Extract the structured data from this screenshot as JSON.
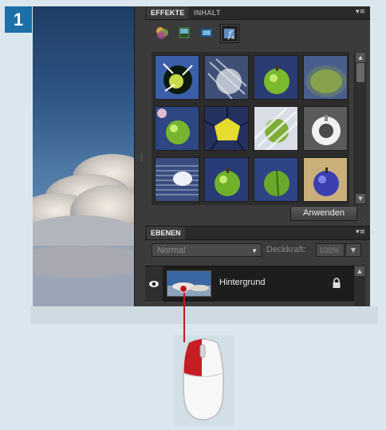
{
  "step_number": "1",
  "effects_panel": {
    "tabs": [
      "EFFEKTE",
      "INHALT"
    ],
    "active_tab": "EFFEKTE",
    "menu_icon": "panel-menu-icon",
    "tool_icons": [
      "color-filter-icon",
      "layer-styles-icon",
      "photo-effects-icon",
      "fx-filter-icon"
    ],
    "selected_tool": "fx-filter-icon",
    "thumbnails": [
      {
        "name": "effect-thumb-1"
      },
      {
        "name": "effect-thumb-2"
      },
      {
        "name": "effect-thumb-3"
      },
      {
        "name": "effect-thumb-4"
      },
      {
        "name": "effect-thumb-5"
      },
      {
        "name": "effect-thumb-6"
      },
      {
        "name": "effect-thumb-7"
      },
      {
        "name": "effect-thumb-8"
      },
      {
        "name": "effect-thumb-9"
      },
      {
        "name": "effect-thumb-10"
      },
      {
        "name": "effect-thumb-11"
      },
      {
        "name": "effect-thumb-12"
      }
    ],
    "apply_label": "Anwenden"
  },
  "layers_panel": {
    "tab": "EBENEN",
    "blend_mode": "Normal",
    "opacity_label": "Deckkraft:",
    "opacity_value": "100%",
    "layers": [
      {
        "name": "Hintergrund",
        "visible": true,
        "locked": true
      }
    ]
  },
  "colors": {
    "accent": "#1d6fa8",
    "pointer": "#c4151c",
    "panel": "#3b3b3b",
    "background": "#dbe7ee"
  }
}
